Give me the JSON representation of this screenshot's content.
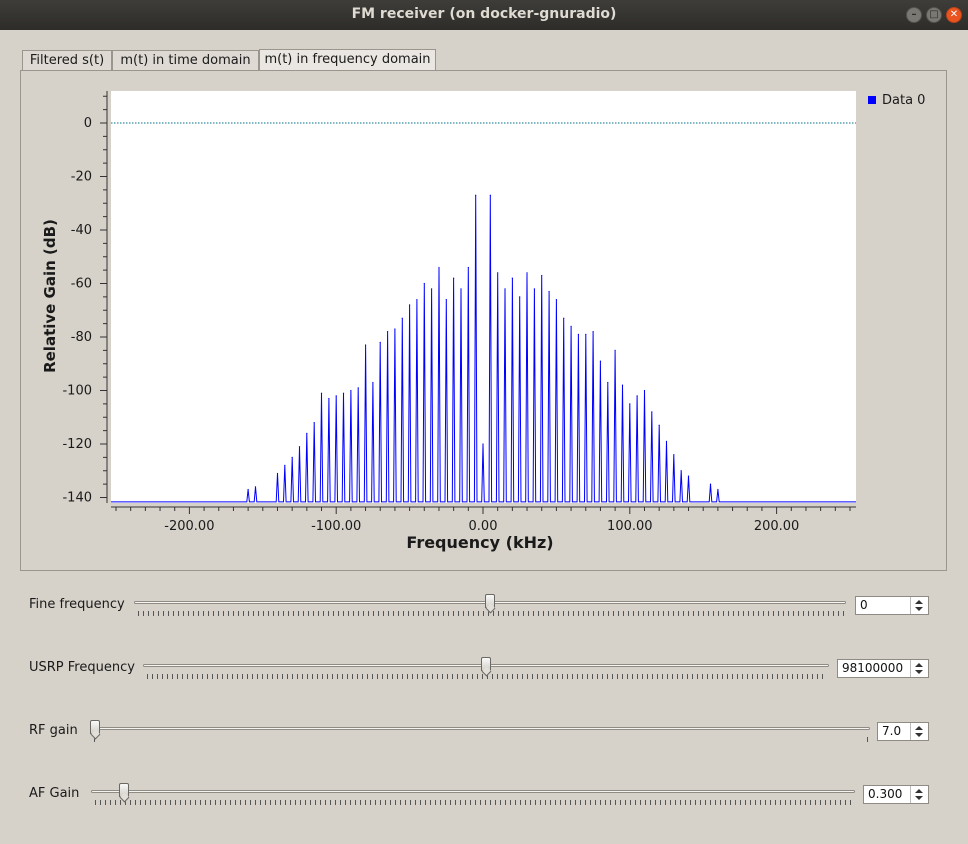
{
  "window": {
    "title": "FM receiver (on docker-gnuradio)"
  },
  "tabs": [
    {
      "label": "Filtered s(t)",
      "active": false
    },
    {
      "label": "m(t) in time domain",
      "active": false
    },
    {
      "label": "m(t) in frequency domain",
      "active": true
    }
  ],
  "chart_data": {
    "type": "line",
    "xlabel": "Frequency (kHz)",
    "ylabel": "Relative Gain (dB)",
    "xlim": [
      -250,
      250
    ],
    "ylim": [
      -142,
      12
    ],
    "x_ticks": [
      "-200.00",
      "-100.00",
      "0.00",
      "100.00",
      "200.00"
    ],
    "y_ticks": [
      "0",
      "-20",
      "-40",
      "-60",
      "-80",
      "-100",
      "-120",
      "-140"
    ],
    "legend": {
      "position": "top-right",
      "entries": [
        "Data 0"
      ]
    },
    "reference_line_db": 0,
    "colors": {
      "series": "#0000ff",
      "reference": "#00738a"
    },
    "series": [
      {
        "name": "Data 0",
        "peak_spacing_khz": 5,
        "floor_db": -142,
        "x": [
          -160,
          -155,
          -140,
          -135,
          -130,
          -125,
          -120,
          -115,
          -110,
          -105,
          -100,
          -95,
          -90,
          -85,
          -80,
          -75,
          -70,
          -65,
          -60,
          -55,
          -50,
          -45,
          -40,
          -35,
          -30,
          -25,
          -20,
          -15,
          -10,
          -5,
          0,
          5,
          10,
          15,
          20,
          25,
          30,
          35,
          40,
          45,
          50,
          55,
          60,
          65,
          70,
          75,
          80,
          85,
          90,
          95,
          100,
          105,
          110,
          115,
          120,
          125,
          130,
          135,
          140,
          155,
          160
        ],
        "y": [
          -137,
          -136,
          -131,
          -128,
          -125,
          -121,
          -116,
          -112,
          -101,
          -103,
          -102,
          -101,
          -100,
          -99,
          -83,
          -97,
          -82,
          -78,
          -77,
          -73,
          -68,
          -66,
          -60,
          -62,
          -54,
          -66,
          -58,
          -62,
          -54,
          -27,
          -120,
          -27,
          -56,
          -62,
          -58,
          -65,
          -56,
          -62,
          -57,
          -63,
          -66,
          -73,
          -76,
          -79,
          -79,
          -78,
          -89,
          -97,
          -85,
          -98,
          -105,
          -102,
          -100,
          -108,
          -113,
          -119,
          -124,
          -130,
          -132,
          -135,
          -137
        ]
      }
    ]
  },
  "controls": [
    {
      "label": "Fine frequency",
      "value": "0",
      "fraction": 0.5
    },
    {
      "label": "USRP Frequency",
      "value": "98100000",
      "fraction": 0.5
    },
    {
      "label": "RF gain",
      "value": "7.0",
      "fraction": 0.0
    },
    {
      "label": "AF Gain",
      "value": "0.300",
      "fraction": 0.037
    }
  ]
}
